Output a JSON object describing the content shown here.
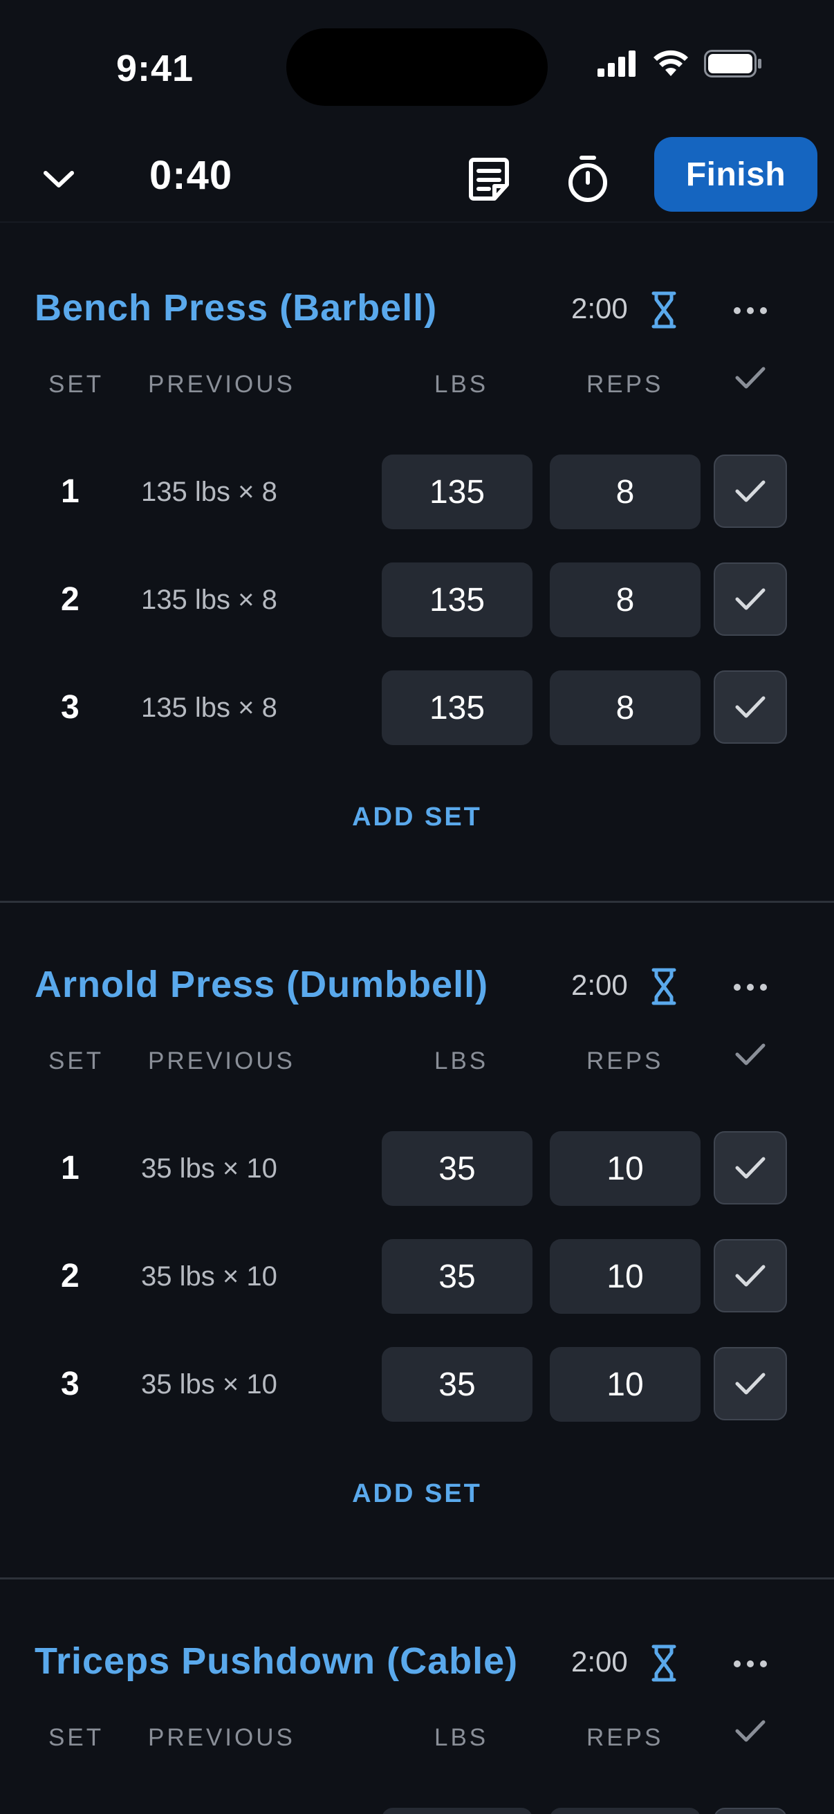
{
  "status_bar": {
    "time": "9:41"
  },
  "toolbar": {
    "elapsed": "0:40",
    "finish_label": "Finish"
  },
  "columns": {
    "set": "SET",
    "previous": "PREVIOUS",
    "lbs": "LBS",
    "reps": "REPS"
  },
  "exercises": [
    {
      "name": "Bench Press (Barbell)",
      "rest": "2:00",
      "add_set_label": "ADD SET",
      "sets": [
        {
          "num": "1",
          "previous": "135 lbs × 8",
          "lbs": "135",
          "reps": "8"
        },
        {
          "num": "2",
          "previous": "135 lbs × 8",
          "lbs": "135",
          "reps": "8"
        },
        {
          "num": "3",
          "previous": "135 lbs × 8",
          "lbs": "135",
          "reps": "8"
        }
      ]
    },
    {
      "name": "Arnold Press (Dumbbell)",
      "rest": "2:00",
      "add_set_label": "ADD SET",
      "sets": [
        {
          "num": "1",
          "previous": "35 lbs × 10",
          "lbs": "35",
          "reps": "10"
        },
        {
          "num": "2",
          "previous": "35 lbs × 10",
          "lbs": "35",
          "reps": "10"
        },
        {
          "num": "3",
          "previous": "35 lbs × 10",
          "lbs": "35",
          "reps": "10"
        }
      ]
    },
    {
      "name": "Triceps Pushdown (Cable)",
      "rest": "2:00"
    }
  ],
  "colors": {
    "accent": "#5aa9ec",
    "primary_button": "#1565c0",
    "background": "#0e1117",
    "field_bg": "#252a33"
  }
}
